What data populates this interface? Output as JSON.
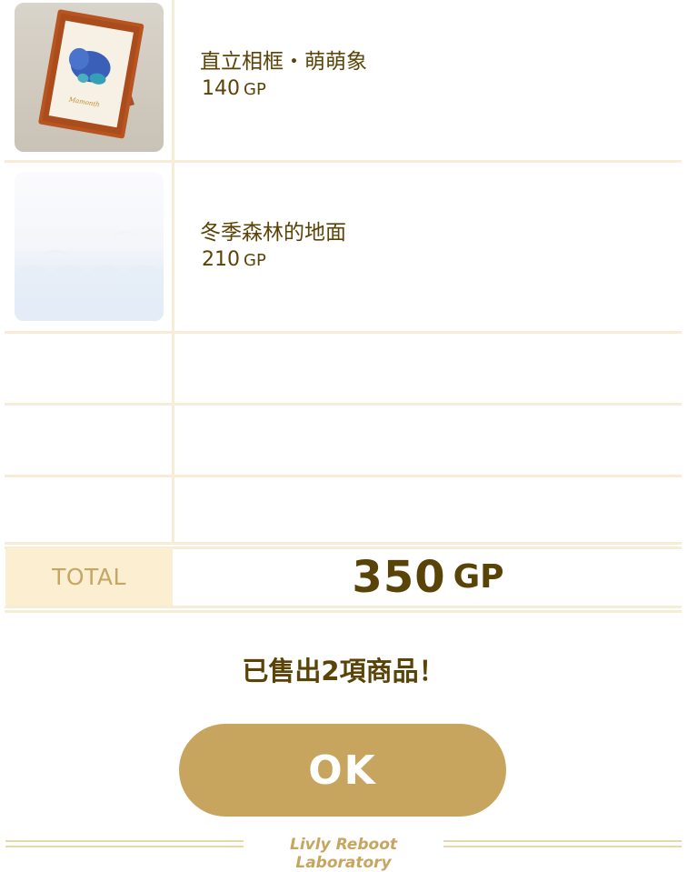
{
  "items": [
    {
      "name": "直立相框・萌萌象",
      "price": "140",
      "unit": "GP",
      "thumb_icon": "elephant-photo-frame-icon",
      "frame_caption": "Mamonth"
    },
    {
      "name": "冬季森林的地面",
      "price": "210",
      "unit": "GP",
      "thumb_icon": "winter-forest-floor-icon"
    }
  ],
  "total": {
    "label": "TOTAL",
    "value": "350",
    "unit": "GP"
  },
  "message": "已售出2項商品！",
  "ok_button": "OK",
  "footer": "Livly Reboot Laboratory",
  "colors": {
    "text_brown": "#5a4306",
    "gold": "#c7a55f",
    "cream": "#fbeed1",
    "line": "#f7ecd6"
  }
}
